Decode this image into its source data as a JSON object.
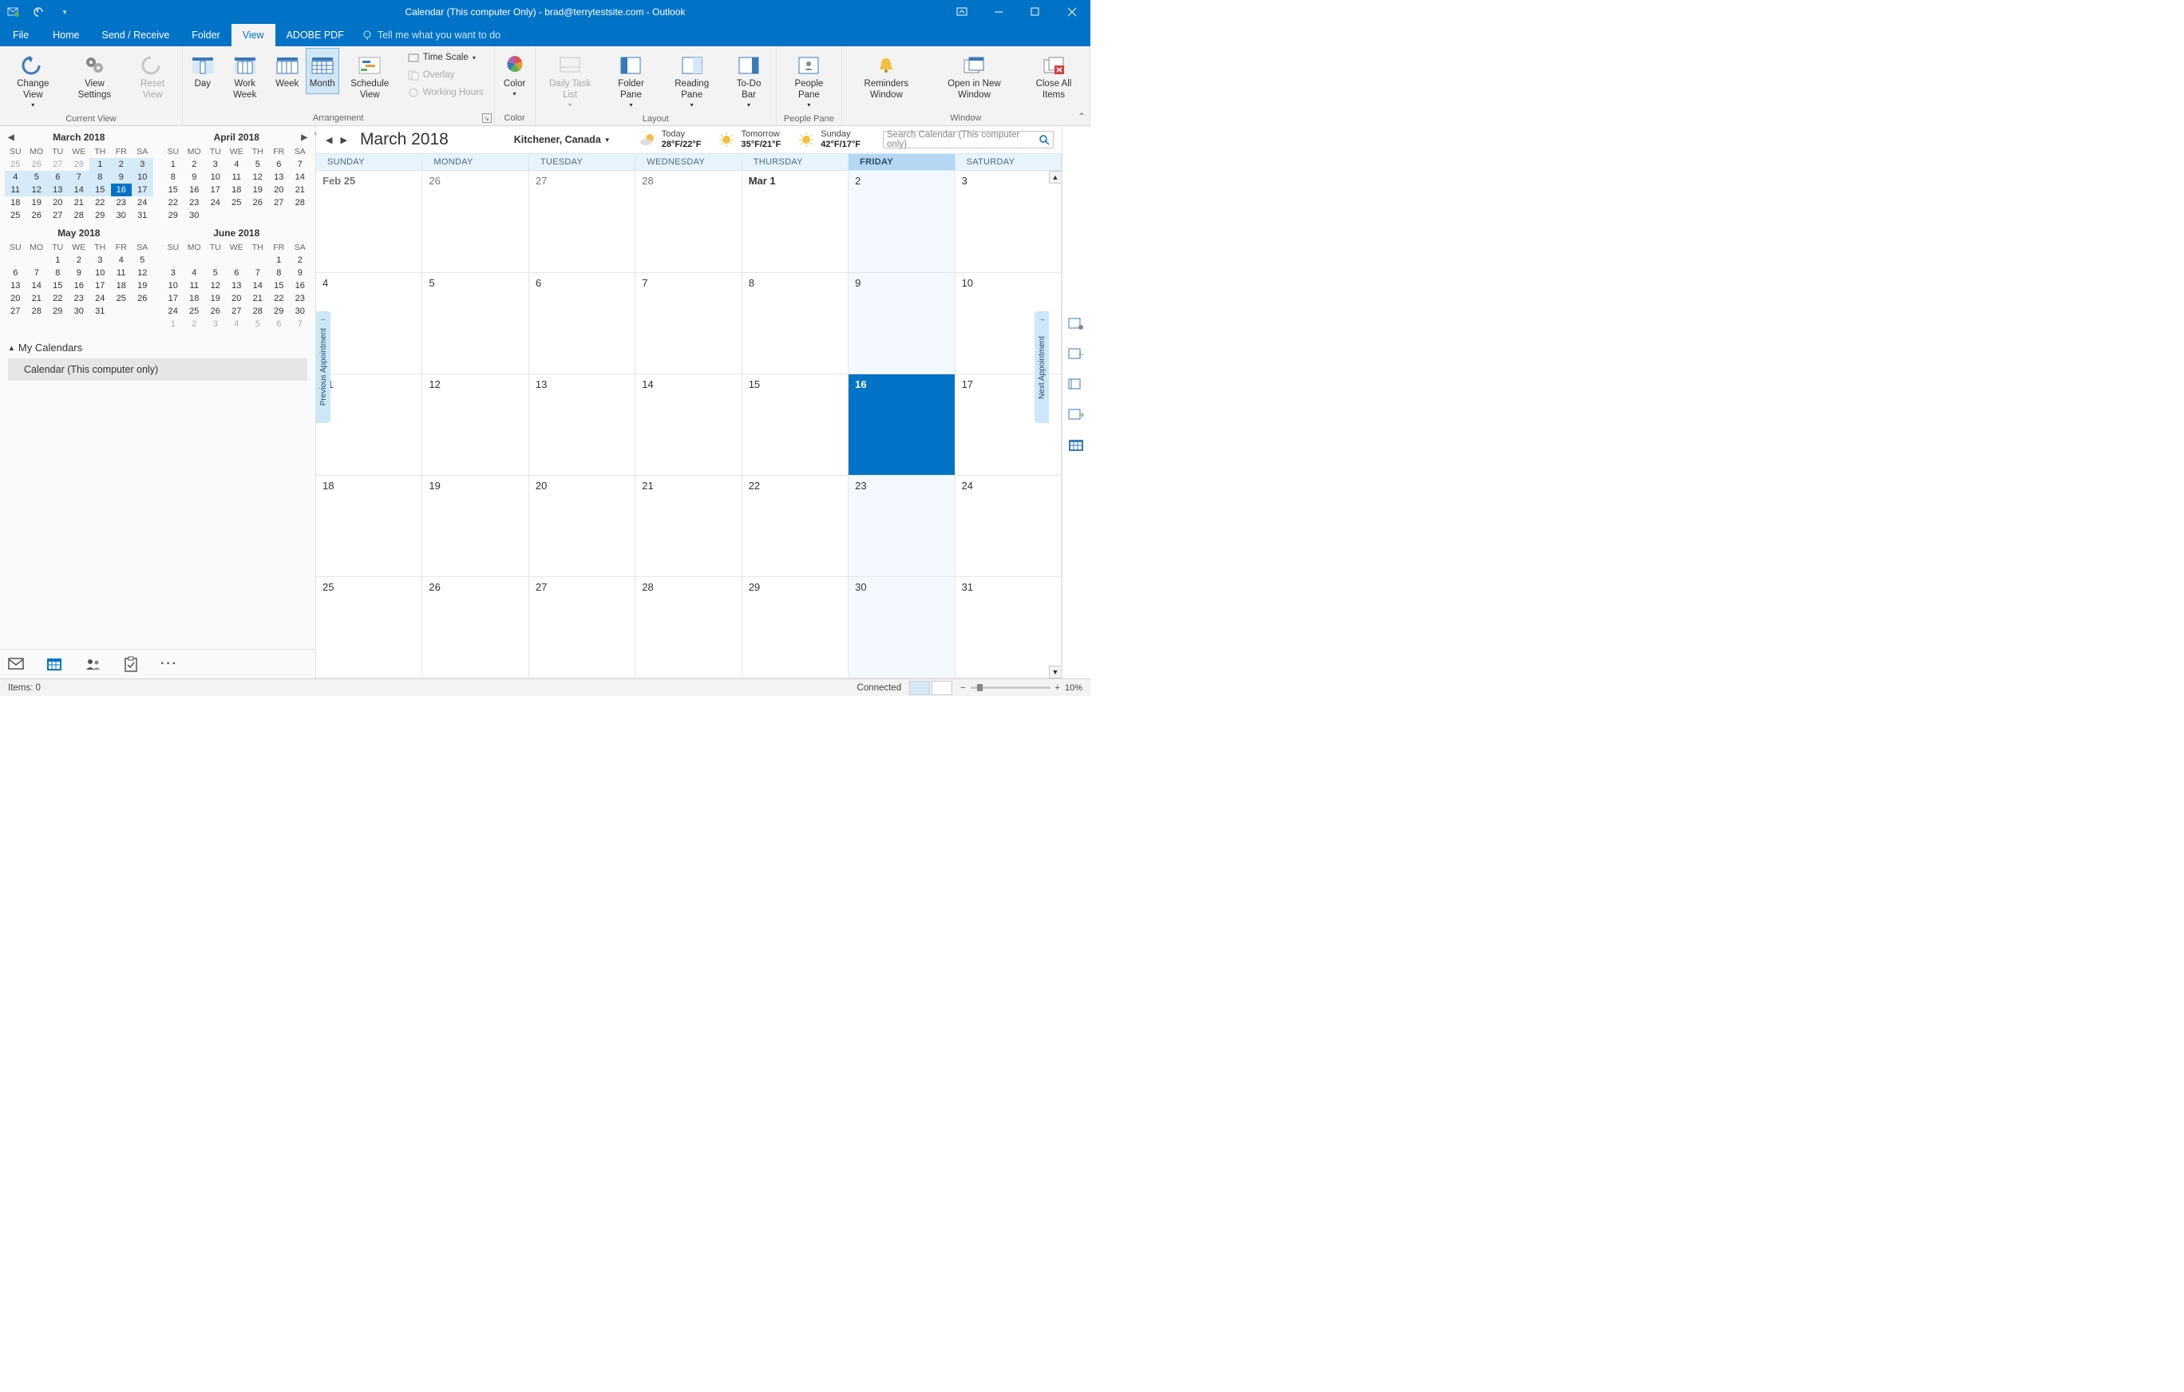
{
  "window": {
    "title": "Calendar (This computer Only) - brad@terrytestsite.com  -  Outlook"
  },
  "menubar": {
    "file": "File",
    "home": "Home",
    "sendreceive": "Send / Receive",
    "folder": "Folder",
    "view": "View",
    "adobe": "ADOBE PDF",
    "tellme": "Tell me what you want to do"
  },
  "ribbon": {
    "changeview": "Change View",
    "viewsettings": "View Settings",
    "resetview": "Reset View",
    "currentview": "Current View",
    "day": "Day",
    "workweek": "Work Week",
    "week": "Week",
    "month": "Month",
    "schedule": "Schedule View",
    "timescale": "Time Scale",
    "overlay": "Overlay",
    "workinghours": "Working Hours",
    "arrangement": "Arrangement",
    "color": "Color",
    "colorgrp": "Color",
    "dailytask": "Daily Task List",
    "folderpane": "Folder Pane",
    "readingpane": "Reading Pane",
    "todobar": "To-Do Bar",
    "layout": "Layout",
    "peoplepane": "People Pane",
    "peoplegrp": "People Pane",
    "reminders": "Reminders Window",
    "openinnew": "Open in New Window",
    "closeall": "Close All Items",
    "windowgrp": "Window"
  },
  "minimonths": {
    "dow": [
      "SU",
      "MO",
      "TU",
      "WE",
      "TH",
      "FR",
      "SA"
    ],
    "m1": {
      "title": "March 2018",
      "leading": [
        "25",
        "26",
        "27",
        "28"
      ],
      "days": 31,
      "today": 16,
      "rangeEnd": 17
    },
    "m2": {
      "title": "April 2018",
      "days": 30,
      "startCol": 0
    },
    "m3": {
      "title": "May 2018",
      "days": 31,
      "startCol": 2,
      "trail": 0
    },
    "m4": {
      "title": "June 2018",
      "days": 30,
      "startCol": 5,
      "trail": 7
    }
  },
  "calendars": {
    "group": "My Calendars",
    "item": "Calendar (This computer only)"
  },
  "calview": {
    "title": "March 2018",
    "location": "Kitchener, Canada",
    "weather": [
      {
        "label": "Today",
        "temp": "28°F/22°F",
        "icon": "partly"
      },
      {
        "label": "Tomorrow",
        "temp": "35°F/21°F",
        "icon": "sun"
      },
      {
        "label": "Sunday",
        "temp": "42°F/17°F",
        "icon": "sun"
      }
    ],
    "searchPlaceholder": "Search Calendar (This computer only)",
    "dow": [
      "SUNDAY",
      "MONDAY",
      "TUESDAY",
      "WEDNESDAY",
      "THURSDAY",
      "FRIDAY",
      "SATURDAY"
    ],
    "todayCol": 5,
    "grid": [
      [
        "Feb 25",
        "26",
        "27",
        "28",
        "Mar 1",
        "2",
        "3"
      ],
      [
        "4",
        "5",
        "6",
        "7",
        "8",
        "9",
        "10"
      ],
      [
        "11",
        "12",
        "13",
        "14",
        "15",
        "16",
        "17"
      ],
      [
        "18",
        "19",
        "20",
        "21",
        "22",
        "23",
        "24"
      ],
      [
        "25",
        "26",
        "27",
        "28",
        "29",
        "30",
        "31"
      ]
    ],
    "todayRow": 2,
    "todayCell": 5,
    "prevAppt": "Previous Appointment",
    "nextAppt": "Next Appointment"
  },
  "status": {
    "items": "Items: 0",
    "connected": "Connected",
    "zoom": "10%"
  }
}
